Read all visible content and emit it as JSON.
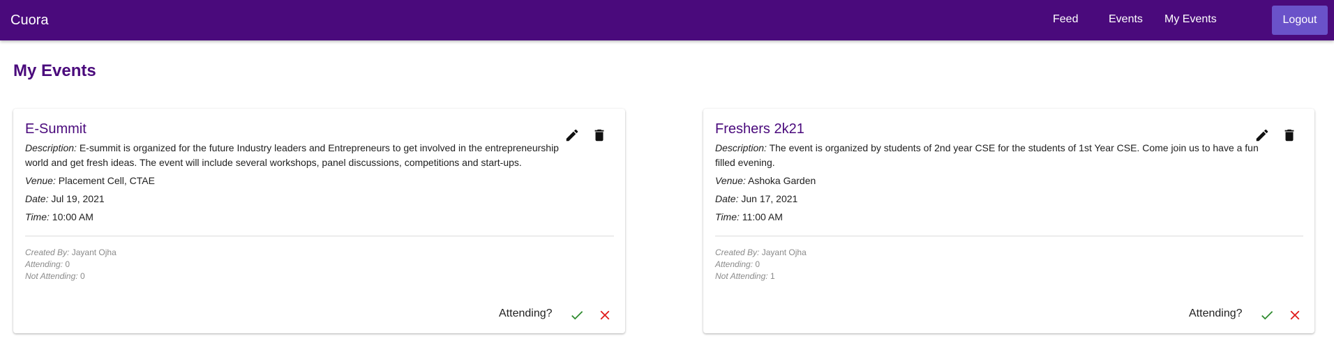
{
  "app": {
    "brand": "Cuora"
  },
  "nav": {
    "feed": "Feed",
    "events": "Events",
    "my_events": "My Events",
    "logout": "Logout"
  },
  "page": {
    "title": "My Events"
  },
  "labels": {
    "description": "Description:",
    "venue": "Venue:",
    "date": "Date:",
    "time": "Time:",
    "created_by": "Created By:",
    "attending": "Attending:",
    "not_attending": "Not Attending:",
    "attending_question": "Attending?"
  },
  "events": [
    {
      "title": "E-Summit",
      "description": "E-summit is organized for the future Industry leaders and Entrepreneurs to get involved in the entrepreneurship world and get fresh ideas. The event will include several workshops, panel discussions, competitions and start-ups.",
      "venue": "Placement Cell, CTAE",
      "date": "Jul 19, 2021",
      "time": "10:00 AM",
      "created_by": "Jayant Ojha",
      "attending": "0",
      "not_attending": "0"
    },
    {
      "title": "Freshers 2k21",
      "description": "The event is organized by students of 2nd year CSE for the students of 1st Year CSE. Come join us to have a fun filled evening.",
      "venue": "Ashoka Garden",
      "date": "Jun 17, 2021",
      "time": "11:00 AM",
      "created_by": "Jayant Ojha",
      "attending": "0",
      "not_attending": "1"
    }
  ],
  "icons": {
    "edit": "edit-icon",
    "delete": "delete-icon",
    "accept": "check-icon",
    "decline": "close-icon"
  },
  "colors": {
    "appbar": "#4a0a7c",
    "logout_button": "#6a52c9",
    "title": "#4a0a7c",
    "accept": "#2e8b2e",
    "decline": "#e01b1b"
  }
}
